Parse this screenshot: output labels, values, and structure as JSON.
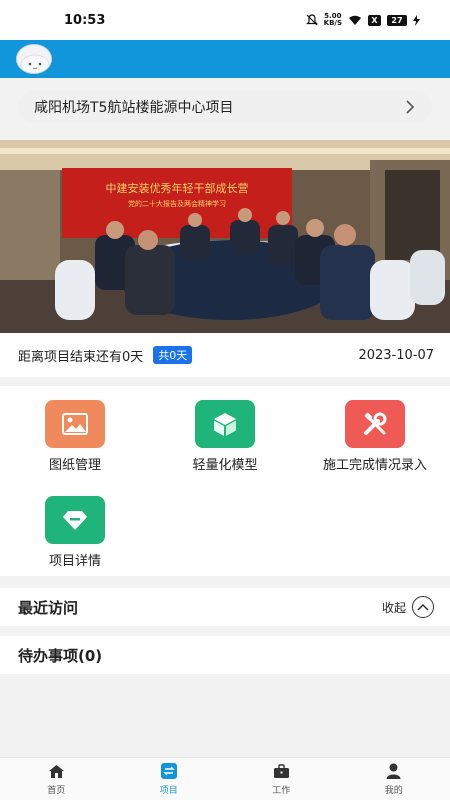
{
  "status_bar": {
    "time": "10:53",
    "net_speed_top": "5.00",
    "net_speed_bottom": "KB/S",
    "x_label": "X",
    "battery": "27"
  },
  "project": {
    "name": "咸阳机场T5航站楼能源中心项目"
  },
  "banner": {
    "slogan": "中建安装优秀年轻干部成长营",
    "subtitle": "党的二十大报告及两会精神学习"
  },
  "countdown": {
    "text": "距离项目结束还有0天",
    "total": "共0天",
    "end_date": "2023-10-07"
  },
  "functions": [
    {
      "label": "图纸管理",
      "icon": "image-icon",
      "color": "#f08a5d"
    },
    {
      "label": "轻量化模型",
      "icon": "cube-icon",
      "color": "#1fb47a"
    },
    {
      "label": "施工完成情况录入",
      "icon": "tools-icon",
      "color": "#ef5a55"
    },
    {
      "label": "项目详情",
      "icon": "gem-icon",
      "color": "#1fb47a"
    }
  ],
  "recent": {
    "title": "最近访问",
    "collapse_label": "收起"
  },
  "todo": {
    "title": "待办事项(0)"
  },
  "tabs": [
    {
      "label": "首页",
      "icon": "home-icon",
      "active": false
    },
    {
      "label": "项目",
      "icon": "switch-icon",
      "active": true
    },
    {
      "label": "工作",
      "icon": "briefcase-icon",
      "active": false
    },
    {
      "label": "我的",
      "icon": "user-icon",
      "active": false
    }
  ],
  "colors": {
    "accent": "#1296db",
    "badge": "#1a73e8"
  }
}
